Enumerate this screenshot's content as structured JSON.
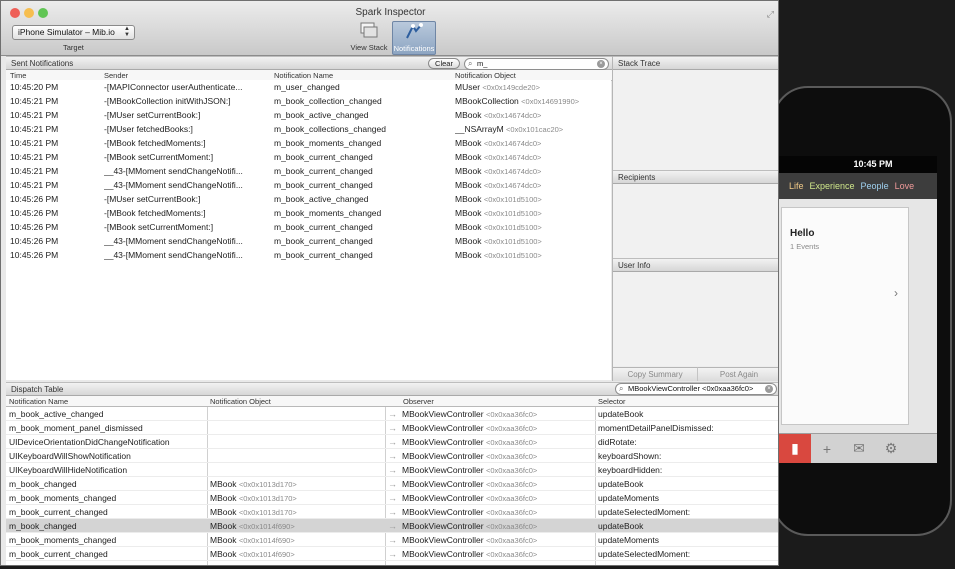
{
  "window": {
    "title": "Spark Inspector"
  },
  "toolbar": {
    "target_value": "iPhone Simulator – Mib.io",
    "target_label": "Target",
    "view_stack_label": "View Stack",
    "notifications_label": "Notifications"
  },
  "sent_notifications": {
    "header": "Sent Notifications",
    "clear_label": "Clear",
    "search_value": "m_",
    "columns": [
      "Time",
      "Sender",
      "Notification Name",
      "Notification Object"
    ],
    "rows": [
      {
        "time": "10:45:20 PM",
        "sender": "-[MAPIConnector userAuthenticate...",
        "name": "m_user_changed",
        "obj": "MUser",
        "addr": "<0x0x149cde20>"
      },
      {
        "time": "10:45:21 PM",
        "sender": "-[MBookCollection initWithJSON:]",
        "name": "m_book_collection_changed",
        "obj": "MBookCollection",
        "addr": "<0x0x14691990>"
      },
      {
        "time": "10:45:21 PM",
        "sender": "-[MUser setCurrentBook:]",
        "name": "m_book_active_changed",
        "obj": "MBook",
        "addr": "<0x0x14674dc0>"
      },
      {
        "time": "10:45:21 PM",
        "sender": "-[MUser fetchedBooks:]",
        "name": "m_book_collections_changed",
        "obj": "__NSArrayM",
        "addr": "<0x0x101cac20>"
      },
      {
        "time": "10:45:21 PM",
        "sender": "-[MBook fetchedMoments:]",
        "name": "m_book_moments_changed",
        "obj": "MBook",
        "addr": "<0x0x14674dc0>"
      },
      {
        "time": "10:45:21 PM",
        "sender": "-[MBook setCurrentMoment:]",
        "name": "m_book_current_changed",
        "obj": "MBook",
        "addr": "<0x0x14674dc0>"
      },
      {
        "time": "10:45:21 PM",
        "sender": "__43-[MMoment sendChangeNotifi...",
        "name": "m_book_current_changed",
        "obj": "MBook",
        "addr": "<0x0x14674dc0>"
      },
      {
        "time": "10:45:21 PM",
        "sender": "__43-[MMoment sendChangeNotifi...",
        "name": "m_book_current_changed",
        "obj": "MBook",
        "addr": "<0x0x14674dc0>"
      },
      {
        "time": "10:45:26 PM",
        "sender": "-[MUser setCurrentBook:]",
        "name": "m_book_active_changed",
        "obj": "MBook",
        "addr": "<0x0x101d5100>"
      },
      {
        "time": "10:45:26 PM",
        "sender": "-[MBook fetchedMoments:]",
        "name": "m_book_moments_changed",
        "obj": "MBook",
        "addr": "<0x0x101d5100>"
      },
      {
        "time": "10:45:26 PM",
        "sender": "-[MBook setCurrentMoment:]",
        "name": "m_book_current_changed",
        "obj": "MBook",
        "addr": "<0x0x101d5100>"
      },
      {
        "time": "10:45:26 PM",
        "sender": "__43-[MMoment sendChangeNotifi...",
        "name": "m_book_current_changed",
        "obj": "MBook",
        "addr": "<0x0x101d5100>"
      },
      {
        "time": "10:45:26 PM",
        "sender": "__43-[MMoment sendChangeNotifi...",
        "name": "m_book_current_changed",
        "obj": "MBook",
        "addr": "<0x0x101d5100>"
      }
    ]
  },
  "side_panels": {
    "stack_trace": "Stack Trace",
    "recipients": "Recipients",
    "user_info": "User Info",
    "copy_summary": "Copy Summary",
    "post_again": "Post Again"
  },
  "dispatch_table": {
    "header": "Dispatch Table",
    "search_value": "MBookViewController <0x0xaa36fc0>",
    "columns": [
      "Notification Name",
      "Notification Object",
      "Observer",
      "Selector"
    ],
    "rows": [
      {
        "name": "m_book_active_changed",
        "obj": "",
        "objaddr": "",
        "observer": "MBookViewController",
        "obsaddr": "<0x0xaa36fc0>",
        "selector": "updateBook"
      },
      {
        "name": "m_book_moment_panel_dismissed",
        "obj": "",
        "objaddr": "",
        "observer": "MBookViewController",
        "obsaddr": "<0x0xaa36fc0>",
        "selector": "momentDetailPanelDismissed:"
      },
      {
        "name": "UIDeviceOrientationDidChangeNotification",
        "obj": "",
        "objaddr": "",
        "observer": "MBookViewController",
        "obsaddr": "<0x0xaa36fc0>",
        "selector": "didRotate:"
      },
      {
        "name": "UIKeyboardWillShowNotification",
        "obj": "",
        "objaddr": "",
        "observer": "MBookViewController",
        "obsaddr": "<0x0xaa36fc0>",
        "selector": "keyboardShown:"
      },
      {
        "name": "UIKeyboardWillHideNotification",
        "obj": "",
        "objaddr": "",
        "observer": "MBookViewController",
        "obsaddr": "<0x0xaa36fc0>",
        "selector": "keyboardHidden:"
      },
      {
        "name": "m_book_changed",
        "obj": "MBook",
        "objaddr": "<0x0x1013d170>",
        "observer": "MBookViewController",
        "obsaddr": "<0x0xaa36fc0>",
        "selector": "updateBook"
      },
      {
        "name": "m_book_moments_changed",
        "obj": "MBook",
        "objaddr": "<0x0x1013d170>",
        "observer": "MBookViewController",
        "obsaddr": "<0x0xaa36fc0>",
        "selector": "updateMoments"
      },
      {
        "name": "m_book_current_changed",
        "obj": "MBook",
        "objaddr": "<0x0x1013d170>",
        "observer": "MBookViewController",
        "obsaddr": "<0x0xaa36fc0>",
        "selector": "updateSelectedMoment:"
      },
      {
        "name": "m_book_changed",
        "obj": "MBook",
        "objaddr": "<0x0x1014f690>",
        "observer": "MBookViewController",
        "obsaddr": "<0x0xaa36fc0>",
        "selector": "updateBook"
      },
      {
        "name": "m_book_moments_changed",
        "obj": "MBook",
        "objaddr": "<0x0x1014f690>",
        "observer": "MBookViewController",
        "obsaddr": "<0x0xaa36fc0>",
        "selector": "updateMoments"
      },
      {
        "name": "m_book_current_changed",
        "obj": "MBook",
        "objaddr": "<0x0x1014f690>",
        "observer": "MBookViewController",
        "obsaddr": "<0x0xaa36fc0>",
        "selector": "updateSelectedMoment:"
      }
    ],
    "selected_index": 8
  },
  "simulator": {
    "time": "10:45 PM",
    "categories": [
      {
        "label": "Life",
        "color": "#f0c987"
      },
      {
        "label": "Experience",
        "color": "#cfe68a"
      },
      {
        "label": "People",
        "color": "#9fd0ef"
      },
      {
        "label": "Love",
        "color": "#f09a9a"
      }
    ],
    "card_title": "Hello",
    "card_subtitle": "1 Events",
    "tab_icons": [
      "book-icon",
      "plus-icon",
      "mail-icon",
      "gear-icon"
    ]
  },
  "colors": {
    "traffic_close": "#ee5f57",
    "traffic_min": "#f6be4f",
    "traffic_max": "#61c554",
    "selection": "#d4d4d4"
  }
}
